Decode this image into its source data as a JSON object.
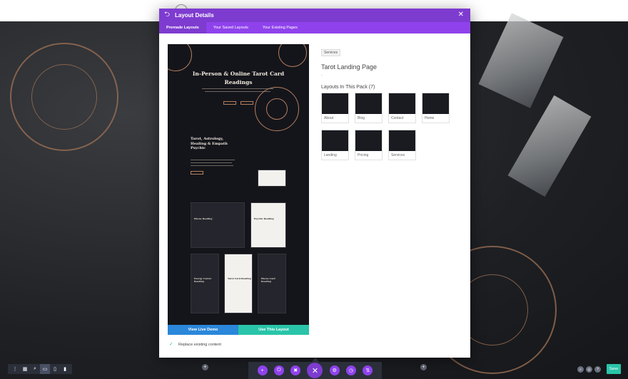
{
  "modal": {
    "title": "Layout Details",
    "tabs": [
      {
        "label": "Premade Layouts",
        "active": true
      },
      {
        "label": "Your Saved Layouts",
        "active": false
      },
      {
        "label": "Your Existing Pages",
        "active": false
      }
    ]
  },
  "preview": {
    "hero_title": "In-Person & Online Tarot Card Readings",
    "section_title": "Tarot, Astrology, Healing & Empath Psychic",
    "cards": [
      "Phone Reading",
      "Psychic Reading",
      "Energy Center Reading",
      "Tarot Card Reading",
      "Phone Card Reading"
    ]
  },
  "buttons": {
    "view_demo": "View Live Demo",
    "use_layout": "Use This Layout"
  },
  "replace_label": "Replace existing content",
  "info": {
    "category": "Services",
    "layout_name": "Tarot Landing Page",
    "dash": "-",
    "pack_title": "Layouts In This Pack (7)",
    "layouts": [
      {
        "label": "About"
      },
      {
        "label": "Blog"
      },
      {
        "label": "Contact"
      },
      {
        "label": "Home"
      },
      {
        "label": "Landing"
      },
      {
        "label": "Pricing"
      },
      {
        "label": "Services"
      }
    ]
  },
  "toolbar": {
    "save_label": "Save"
  },
  "colors": {
    "primary_purple": "#7e3bd0",
    "tab_purple": "#8f42ec",
    "demo_blue": "#2b87da",
    "use_teal": "#29c4a9"
  }
}
